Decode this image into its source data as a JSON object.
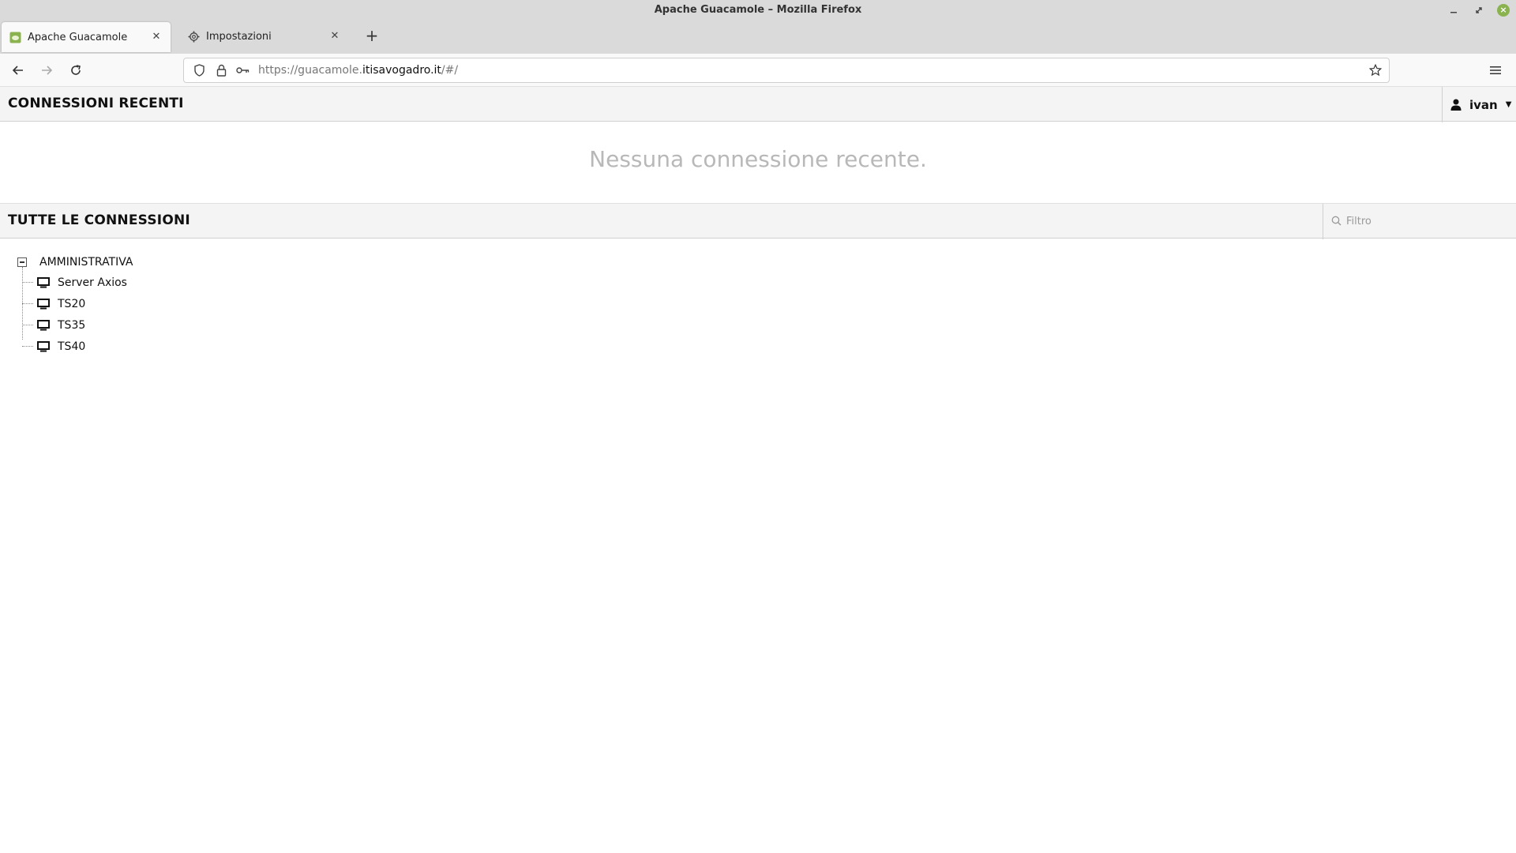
{
  "window": {
    "title": "Apache Guacamole – Mozilla Firefox"
  },
  "tabs": [
    {
      "label": "Apache Guacamole",
      "favicon": "guacamole-icon",
      "active": true
    },
    {
      "label": "Impostazioni",
      "favicon": "gear-icon",
      "active": false
    }
  ],
  "navbar": {
    "url_prefix": "https://guacamole.",
    "url_host": "itisavogadro.it",
    "url_suffix": "/#/"
  },
  "recent": {
    "title": "CONNESSIONI RECENTI",
    "empty_message": "Nessuna connessione recente."
  },
  "user": {
    "name": "ivan"
  },
  "all_connections": {
    "title": "TUTTE LE CONNESSIONI",
    "filter_placeholder": "Filtro",
    "group": {
      "name": "AMMINISTRATIVA",
      "connections": [
        "Server Axios",
        "TS20",
        "TS35",
        "TS40"
      ]
    }
  },
  "colors": {
    "favicon_green": "#8ab34f",
    "chrome_bg": "#dadada"
  }
}
